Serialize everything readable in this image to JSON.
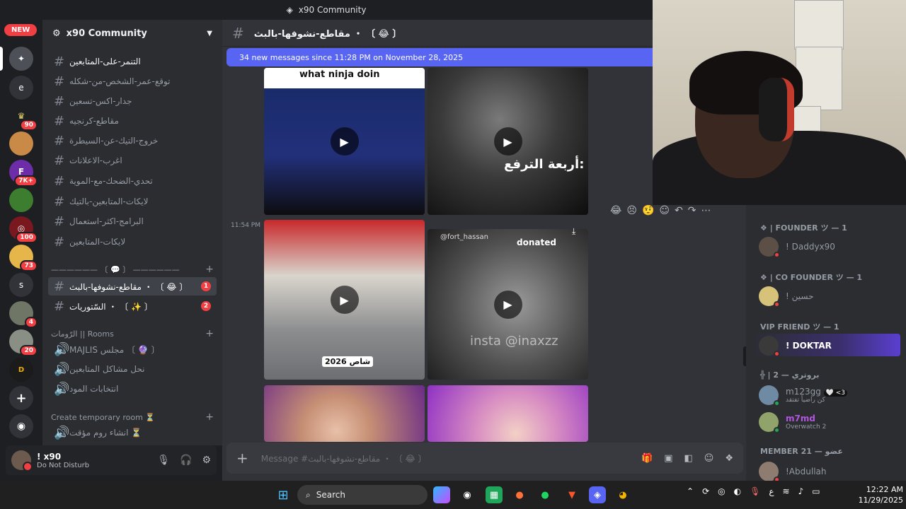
{
  "window": {
    "title": "x90 Community"
  },
  "rail": {
    "new_label": "NEW",
    "servers": [
      {
        "letter": "",
        "badge": ""
      },
      {
        "letter": "e",
        "badge": ""
      },
      {
        "letter": "",
        "badge": "90"
      },
      {
        "letter": "",
        "badge": ""
      },
      {
        "letter": "",
        "badge": "7K+"
      },
      {
        "letter": "",
        "badge": ""
      },
      {
        "letter": "",
        "badge": "100"
      },
      {
        "letter": "",
        "badge": "73"
      },
      {
        "letter": "s",
        "badge": ""
      },
      {
        "letter": "",
        "badge": "4"
      },
      {
        "letter": "",
        "badge": "20"
      },
      {
        "letter": "",
        "badge": ""
      }
    ]
  },
  "sidebar": {
    "server_name": "x90 Community",
    "channels": [
      {
        "name": "التنمر-على-المتابعين",
        "unread": true
      },
      {
        "name": "توقع-عمر-الشخص-من-شكله",
        "unread": false
      },
      {
        "name": "جدار-اكس-تسعين",
        "unread": false
      },
      {
        "name": "مقاطع-كرنجيه",
        "unread": false
      },
      {
        "name": "خروج-التيك-عن-السيطرة",
        "unread": false
      },
      {
        "name": "اغرب-الاعلانات",
        "unread": false
      },
      {
        "name": "تحدي-الضحك-مع-الموية",
        "unread": false
      },
      {
        "name": "لايكات-المتابعين-بالتيك",
        "unread": false
      },
      {
        "name": "البرامج-اكثر-استعمال",
        "unread": false
      },
      {
        "name": "لايكات-المتابعين",
        "unread": false
      }
    ],
    "divider_label": "—————— 〔 💬 〕 ——————",
    "active_channel": {
      "name": "مقاطع-نشوفها-بالبث ・ 〔 😂 〕",
      "count": "1"
    },
    "second_channel": {
      "name": "السّتوريات ・ 〔 ✨ 〕",
      "count": "2"
    },
    "rooms_category": "الرّومات || Rooms",
    "voice": [
      {
        "name": "MAJLIS مجلس 〔 🔮 〕"
      },
      {
        "name": "نحل مشاكل المتابعين"
      },
      {
        "name": "انتخابات المود"
      }
    ],
    "temp_category": "Create temporary room ⏳",
    "temp_room": "انشاء روم مؤقت ⏳"
  },
  "user": {
    "name": "! x90",
    "status": "Do Not Disturb"
  },
  "chat": {
    "channel_title": "مقاطع-نشوفها-بالبث ・ 〔 😂 〕",
    "new_messages_banner": "34 new messages since 11:28 PM on November 28, 2025",
    "timestamp": "11:54 PM",
    "media": [
      {
        "caption": "what ninja doin"
      },
      {
        "caption": "أربعة الترفع:"
      },
      {
        "caption": "2026 شاص"
      },
      {
        "caption": "donated"
      }
    ],
    "media_small_text": "@fort_hassan",
    "watermark": "insta @inaxzz",
    "composer_placeholder": "Message #مقاطع-نشوفها-بالبث ・ 〔 😂 〕",
    "reactions": [
      "😂",
      "😣",
      "🤨"
    ]
  },
  "members": {
    "groups": [
      {
        "title": "❖ | FOUNDER ツ — 1",
        "members": [
          {
            "name": "! Daddyx90",
            "sub": ""
          }
        ]
      },
      {
        "title": "❖ | CO FOUNDER ツ — 1",
        "members": [
          {
            "name": "! حسين",
            "sub": ""
          }
        ]
      },
      {
        "title": "VIP FRIEND ツ — 1",
        "members": [
          {
            "name": "! DOKTAR",
            "sub": ""
          }
        ]
      },
      {
        "title": "╬ | بروتري — 2",
        "members": [
          {
            "name": "m123gg",
            "sub": "كن راضياً تفتقد"
          },
          {
            "name": "m7md",
            "sub": "Overwatch 2"
          }
        ]
      },
      {
        "title": "MEMBER 21 — عضو",
        "members": [
          {
            "name": "!Abdullah",
            "sub": ""
          }
        ]
      }
    ],
    "m123gg_tag": "🤍 <3"
  },
  "taskbar": {
    "search_label": "Search",
    "time": "12:22 AM",
    "date": "11/29/2025",
    "tray_lang": "ع"
  },
  "colors": {
    "accent": "#5865f2",
    "danger": "#f23f43",
    "bg": "#313338",
    "sidebar": "#2b2d31"
  }
}
